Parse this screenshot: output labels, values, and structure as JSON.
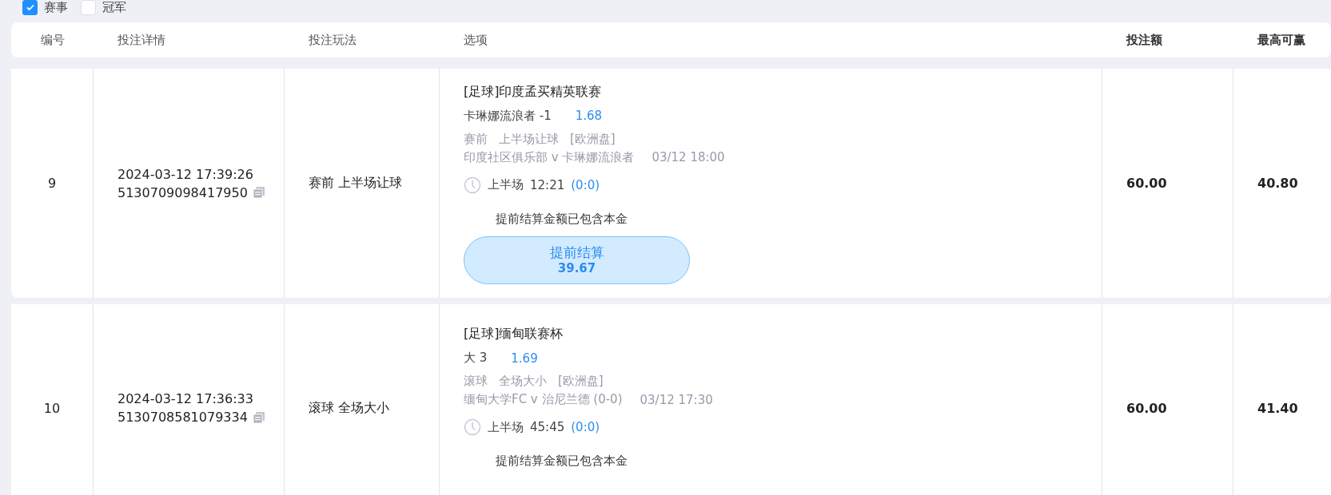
{
  "filters": [
    {
      "label": "赛事",
      "checked": true
    },
    {
      "label": "冠军",
      "checked": false
    }
  ],
  "columns": [
    "编号",
    "投注详情",
    "投注玩法",
    "选项",
    "投注额",
    "最高可赢"
  ],
  "rows": [
    {
      "no": "9",
      "time": "2024-03-12 17:39:26",
      "order_id": "5130709098417950",
      "play": "赛前 上半场让球",
      "league": "[足球]印度孟买精英联赛",
      "pick": "卡琳娜流浪者 -1",
      "odds": "1.68",
      "market": [
        "赛前",
        "上半场让球",
        "[欧洲盘]"
      ],
      "match": "印度社区俱乐部 v 卡琳娜流浪者",
      "match_time": "03/12 18:00",
      "period": "上半场",
      "clock": "12:21",
      "score": "(0:0)",
      "note": "提前结算金额已包含本金",
      "cashout": {
        "label": "提前结算",
        "amount": "39.67"
      },
      "stake": "60.00",
      "max_win": "40.80"
    },
    {
      "no": "10",
      "time": "2024-03-12 17:36:33",
      "order_id": "5130708581079334",
      "play": "滚球 全场大小",
      "league": "[足球]缅甸联赛杯",
      "pick": "大 3",
      "odds": "1.69",
      "market": [
        "滚球",
        "全场大小",
        "[欧洲盘]"
      ],
      "match": "缅甸大学FC v 治尼兰德 (0-0)",
      "match_time": "03/12 17:30",
      "period": "上半场",
      "clock": "45:45",
      "score": "(0:0)",
      "note": "提前结算金额已包含本金",
      "stake": "60.00",
      "max_win": "41.40"
    }
  ]
}
